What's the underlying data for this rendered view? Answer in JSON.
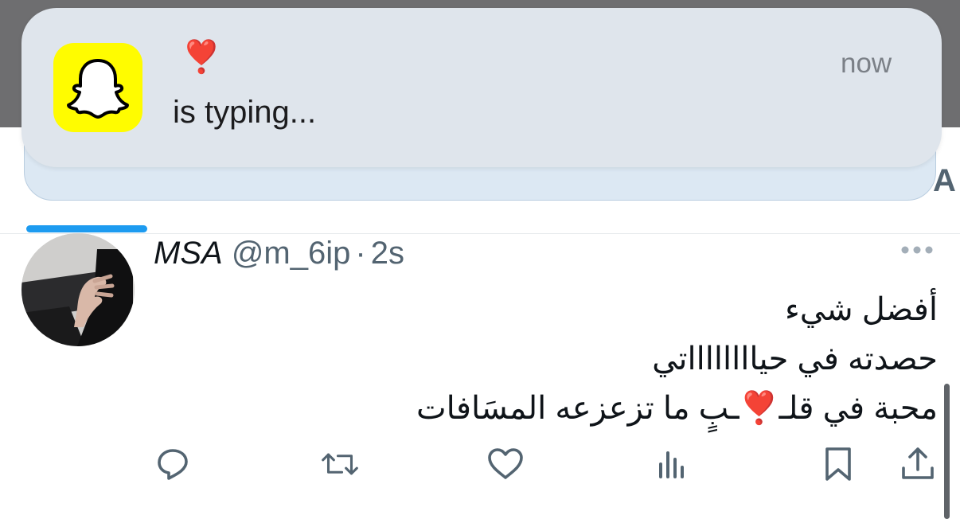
{
  "notification": {
    "app_icon": "snapchat-ghost-icon",
    "sender": "❣️",
    "message": "is typing...",
    "time": "now"
  },
  "tabs": {
    "peek_letter": "A",
    "accent": "#1d9bf0"
  },
  "tweet": {
    "display_name": "MSA",
    "handle": "@m_6ip",
    "separator": "·",
    "time": "2s",
    "lines": [
      "أفضل شيء",
      "حصدته في حيااااااااتي"
    ],
    "line3_before": "محبة في قلـ",
    "line3_heart": "❣️",
    "line3_after": "ـبٍ ما تزعزعه المسَافات",
    "actions": [
      "reply-icon",
      "retweet-icon",
      "like-icon",
      "views-icon",
      "bookmark-icon",
      "share-icon"
    ]
  },
  "colors": {
    "snapchat_yellow": "#fffc00",
    "heart_red": "#e0242f",
    "secondary_text": "#536471"
  }
}
